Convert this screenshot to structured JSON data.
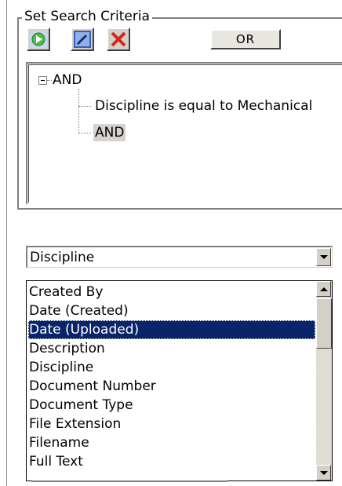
{
  "search_criteria": {
    "title": "Set Search Criteria",
    "toolbar": {
      "run_icon": "green-play-icon",
      "edit_icon": "edit-pen-icon",
      "delete_icon": "red-x-icon",
      "or_label": "OR"
    },
    "tree": {
      "root_label": "AND",
      "children": [
        "Discipline is equal to Mechanical",
        "AND"
      ]
    }
  },
  "field_select": {
    "selected_value": "Discipline",
    "options": [
      "Created By",
      "Date (Created)",
      "Date (Uploaded)",
      "Description",
      "Discipline",
      "Document Number",
      "Document Type",
      "File Extension",
      "Filename",
      "Full Text"
    ],
    "highlighted_option": "Date (Uploaded)"
  },
  "colors": {
    "highlight": "#0a246a",
    "button_face": "#d4d0c8",
    "tree_selection": "#d6d3ce"
  }
}
